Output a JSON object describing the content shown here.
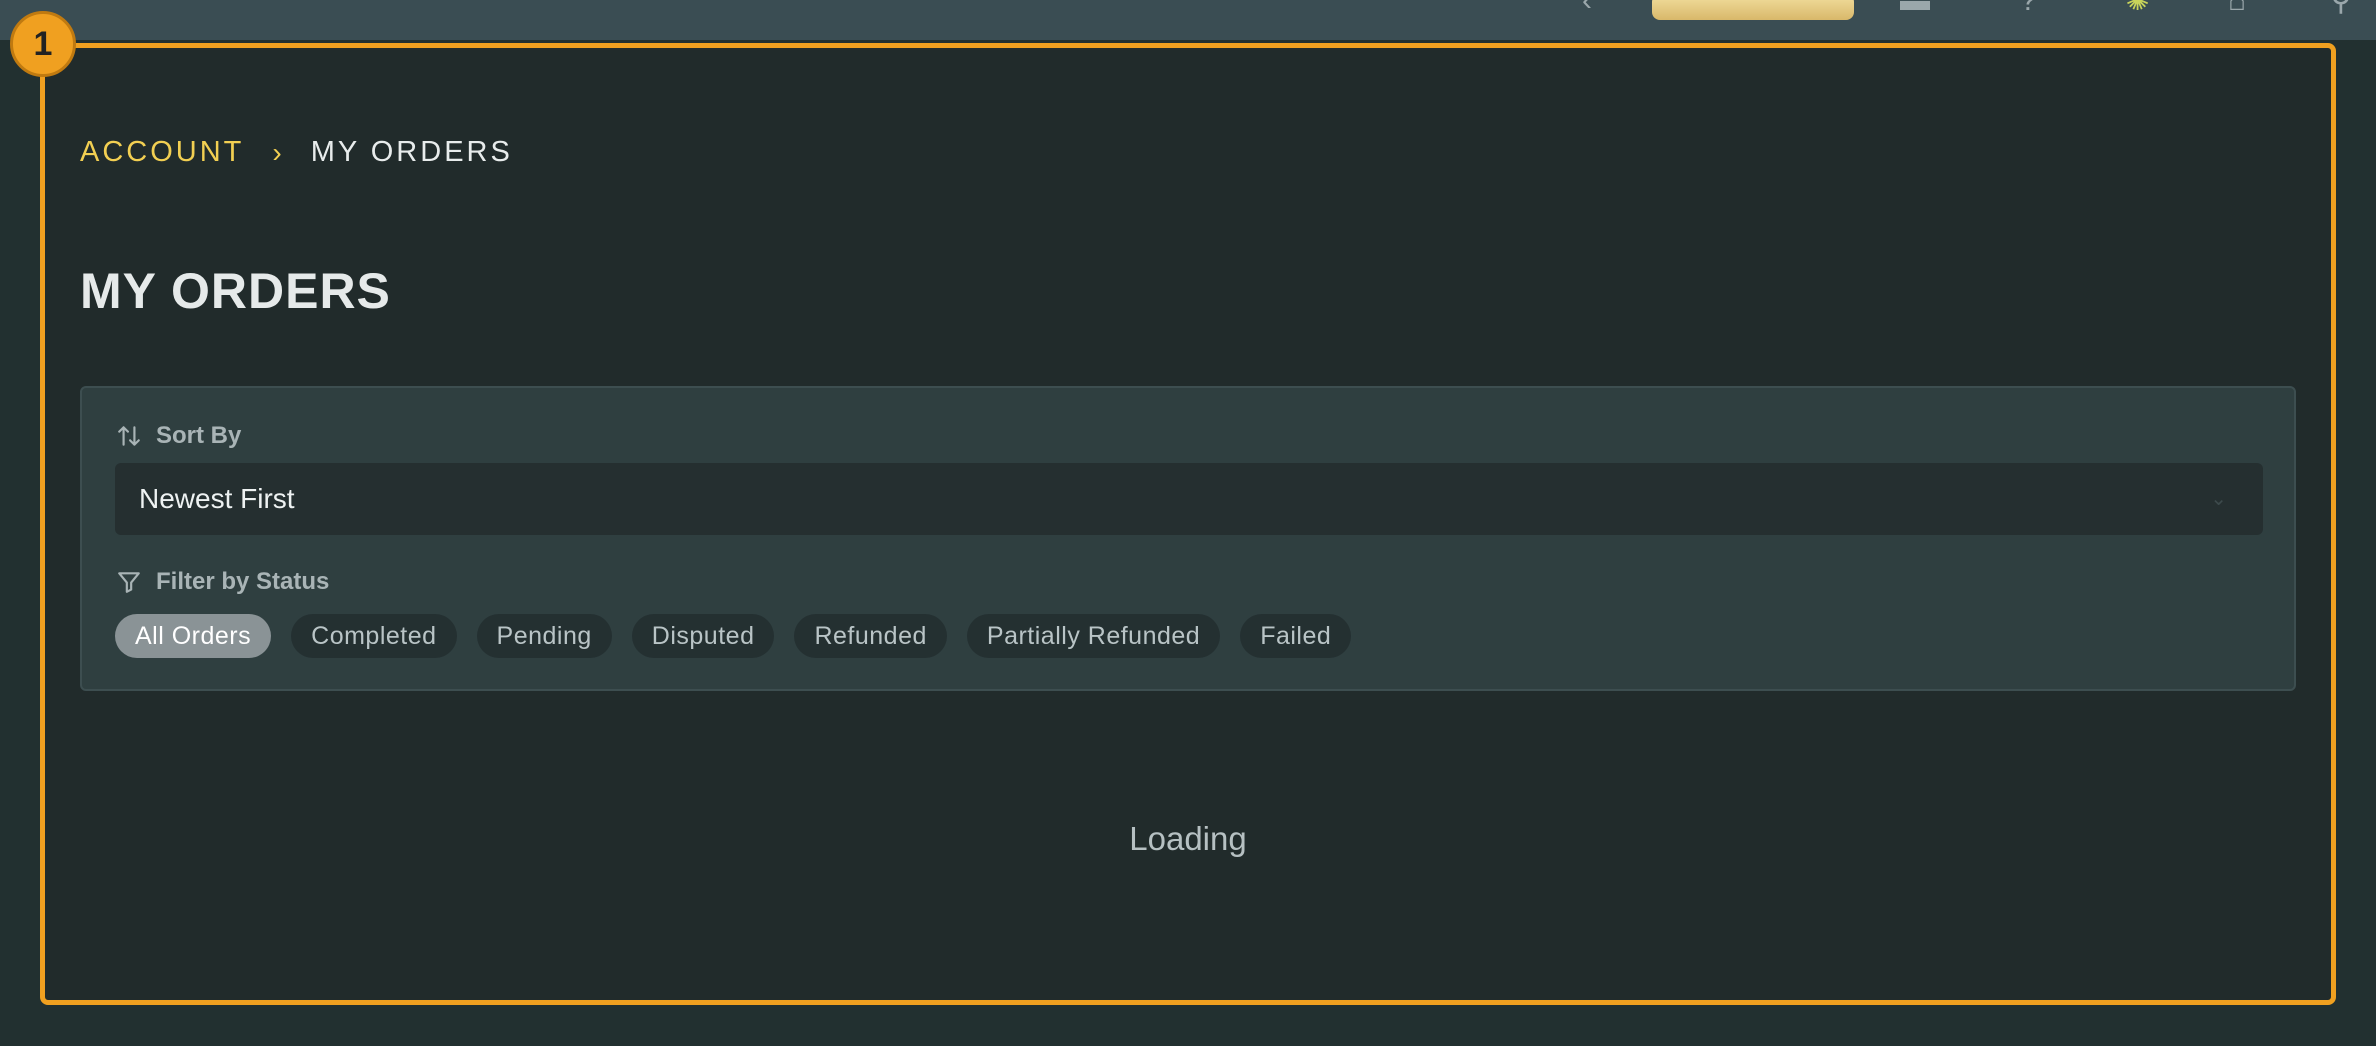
{
  "marker": {
    "label": "1"
  },
  "breadcrumb": {
    "parent": "ACCOUNT",
    "separator": "›",
    "current": "MY ORDERS"
  },
  "page": {
    "title": "MY ORDERS"
  },
  "sort": {
    "label": "Sort By",
    "icon": "sort-arrows-icon",
    "selected": "Newest First"
  },
  "filter": {
    "label": "Filter by Status",
    "icon": "funnel-icon",
    "chips": [
      {
        "label": "All Orders",
        "active": true
      },
      {
        "label": "Completed",
        "active": false
      },
      {
        "label": "Pending",
        "active": false
      },
      {
        "label": "Disputed",
        "active": false
      },
      {
        "label": "Refunded",
        "active": false
      },
      {
        "label": "Partially Refunded",
        "active": false
      },
      {
        "label": "Failed",
        "active": false
      }
    ]
  },
  "status": {
    "loading_text": "Loading"
  },
  "colors": {
    "accent": "#f2cf52",
    "frame": "#f0a020",
    "background": "#212b2b",
    "panel": "#2f3f40"
  }
}
